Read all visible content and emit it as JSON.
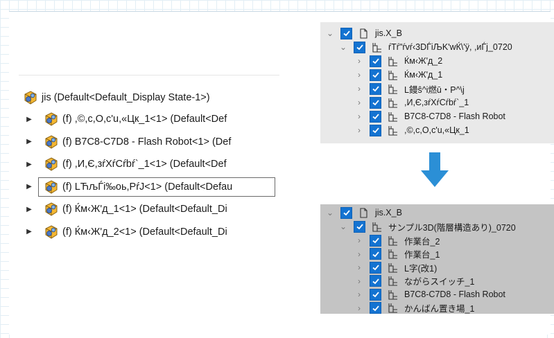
{
  "left_tree": {
    "root_label": "jis  (Default<Default_Display State-1>)",
    "rows": [
      {
        "label": "(f) ,©,c,O,c'u,«Цк_1<1> (Default<Def",
        "selected": false
      },
      {
        "label": "(f) B7C8-C7D8 - Flash Robot<1> (Def",
        "selected": false
      },
      {
        "label": "(f) ,И,Є,зŕXŕCŕbŕ`_1<1> (Default<Def",
        "selected": false
      },
      {
        "label": "(f) LЋљЃi‰oь,PŕJ<1> (Default<Defau",
        "selected": true
      },
      {
        "label": "(f) Ќм‹Ж'д_1<1> (Default<Default_Di",
        "selected": false
      },
      {
        "label": "(f) Ќм‹Ж'д_2<1> (Default<Default_Di",
        "selected": false
      }
    ]
  },
  "top_tree": {
    "root_label": "jis.X_B",
    "group_label": "ŕTŕ\"ŕvŕ‹3DЃiЉK'wЌ\\'ÿ, ,иЃj_0720",
    "items": [
      "Ќм‹Ж'д_2",
      "Ќм‹Ж'д_1",
      "L鏝ŝ^i燃ū・P^\\j",
      ",И,Є,зŕXŕCŕbŕ`_1",
      "B7C8-C7D8 - Flash Robot",
      ",©,c,O,c'u,«Цк_1"
    ]
  },
  "bottom_tree": {
    "root_label": "jis.X_B",
    "group_label": "サンプル3D(階層構造あり)_0720",
    "items": [
      "作業台_2",
      "作業台_1",
      "L字(改1)",
      "ながらスイッチ_1",
      "B7C8-C7D8 - Flash Robot",
      "かんばん置き場_1"
    ]
  },
  "colors": {
    "checkbox_blue": "#1473d1",
    "arrow_blue": "#2b8fd6",
    "top_panel_bg": "#e9e9e9",
    "bottom_panel_bg": "#c4c4c4"
  },
  "icons": [
    "assembly-icon",
    "part-assembly-icon",
    "expand-arrow-icon",
    "chevron-right-icon",
    "chevron-down-icon",
    "checkbox-checked-icon",
    "document-icon",
    "tree-node-icon",
    "down-arrow-icon"
  ]
}
